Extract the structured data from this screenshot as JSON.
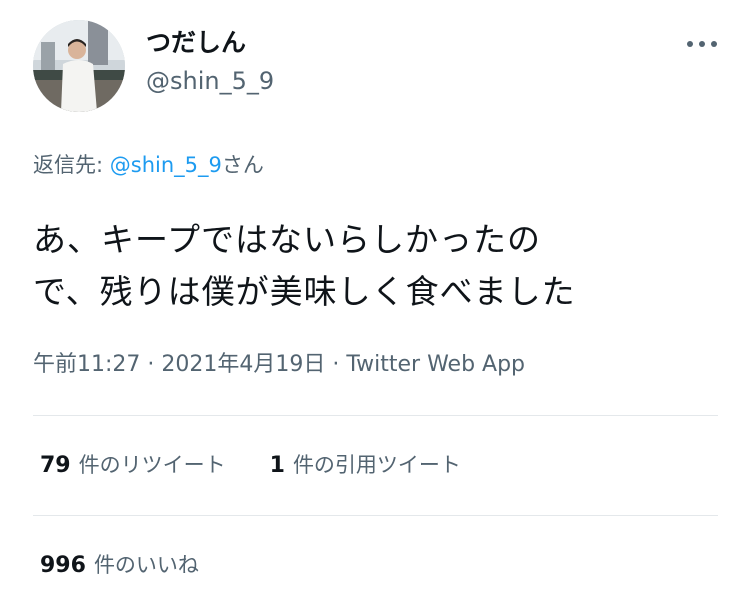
{
  "author": {
    "display_name": "つだしん",
    "handle": "@shin_5_9"
  },
  "reply": {
    "prefix": "返信先: ",
    "mention": "@shin_5_9",
    "suffix": "さん"
  },
  "tweet": {
    "text_lines": [
      "あ、キープではないらしかったの",
      "で、残りは僕が美味しく食べました"
    ],
    "time": "午前11:27",
    "separator": " · ",
    "date": "2021年4月19日",
    "source": "Twitter Web App"
  },
  "stats": {
    "retweets": {
      "count": "79",
      "label": "件のリツイート"
    },
    "quotes": {
      "count": "1",
      "label": "件の引用ツイート"
    },
    "likes": {
      "count": "996",
      "label": "件のいいね"
    }
  },
  "icons": {
    "more": "more-dots-icon"
  },
  "colors": {
    "mention": "#1d9bf0",
    "secondary_text": "#536471",
    "primary_text": "#0f1419",
    "divider": "#e4e8eb"
  }
}
